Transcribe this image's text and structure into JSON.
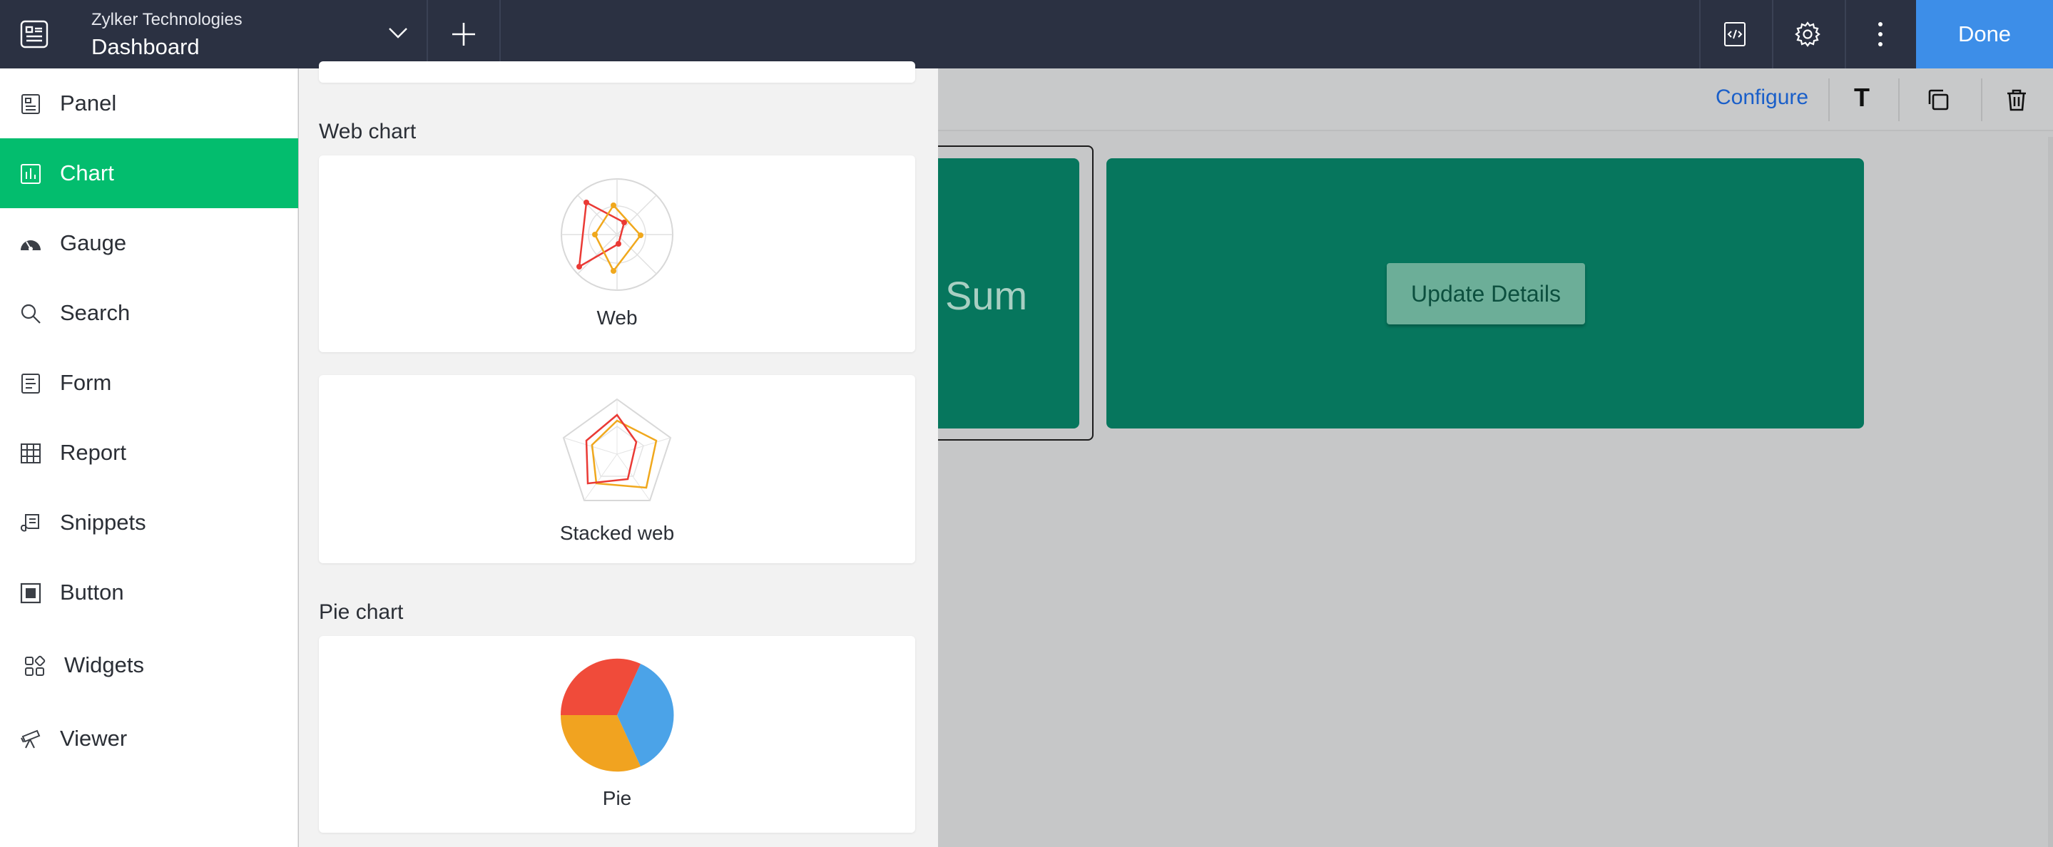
{
  "header": {
    "org_name": "Zylker Technologies",
    "dashboard_name": "Dashboard",
    "done_label": "Done"
  },
  "sidebar": {
    "items": [
      {
        "label": "Panel",
        "icon": "panel-icon"
      },
      {
        "label": "Chart",
        "icon": "chart-icon",
        "active": true
      },
      {
        "label": "Gauge",
        "icon": "gauge-icon"
      },
      {
        "label": "Search",
        "icon": "search-icon"
      },
      {
        "label": "Form",
        "icon": "form-icon"
      },
      {
        "label": "Report",
        "icon": "report-icon"
      },
      {
        "label": "Snippets",
        "icon": "snippets-icon"
      },
      {
        "label": "Button",
        "icon": "button-icon"
      },
      {
        "label": "Widgets",
        "icon": "widgets-icon"
      },
      {
        "label": "Viewer",
        "icon": "viewer-icon"
      }
    ]
  },
  "picker": {
    "sections": [
      {
        "title": "Web chart",
        "cards": [
          {
            "label": "Web",
            "icon": "web-chart-icon"
          },
          {
            "label": "Stacked web",
            "icon": "stacked-web-chart-icon"
          }
        ]
      },
      {
        "title": "Pie chart",
        "cards": [
          {
            "label": "Pie",
            "icon": "pie-chart-icon"
          }
        ]
      }
    ]
  },
  "toolbar": {
    "configure_label": "Configure",
    "text_label": "T"
  },
  "canvas": {
    "panel_text": "Sum",
    "update_button_label": "Update Details"
  },
  "colors": {
    "topbar": "#2b3142",
    "active": "#03bd6e",
    "panel": "#06765d",
    "done": "#3d8ee8",
    "link": "#1a5fc9"
  }
}
